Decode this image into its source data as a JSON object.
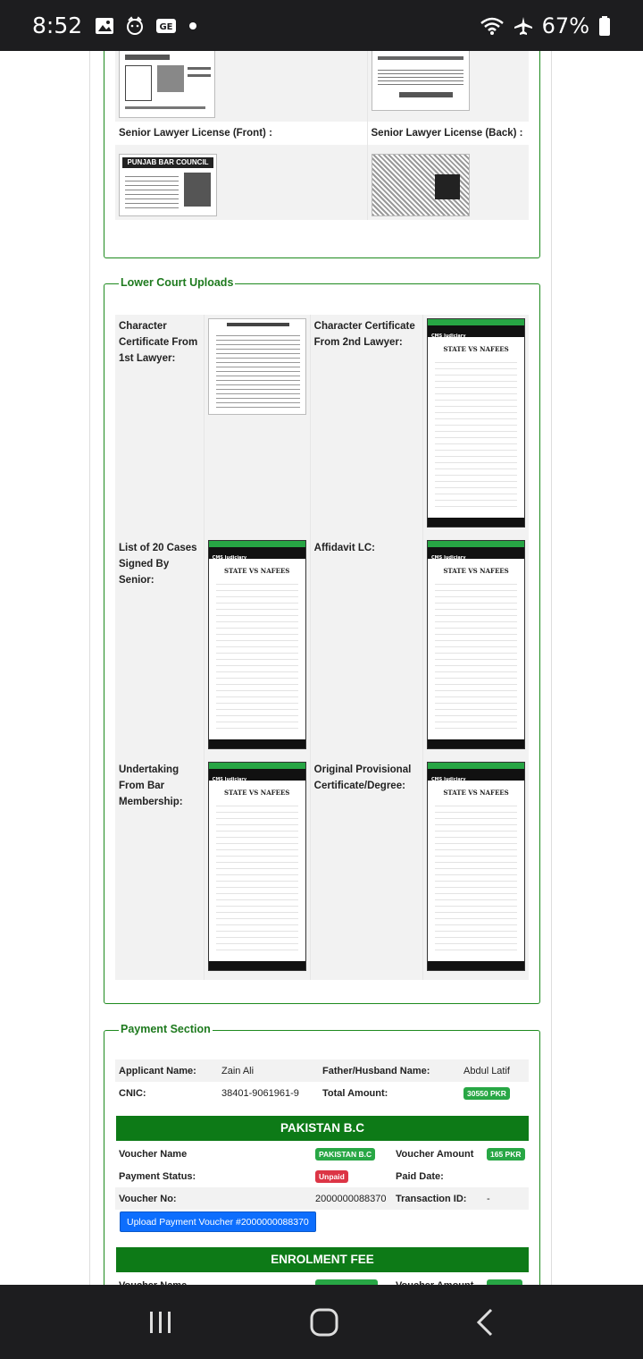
{
  "status_bar": {
    "time": "8:52",
    "battery": "67%"
  },
  "prev_section": {
    "rows": [
      {
        "left_label": "Senior Lawyer License (Front) :",
        "right_label": "Senior Lawyer License (Back) :"
      }
    ],
    "punjab_card_text": "PUNJAB BAR COUNCIL"
  },
  "lower_court": {
    "title": "Lower Court Uploads",
    "items": [
      {
        "label": "Character Certificate From 1st Lawyer:"
      },
      {
        "label": "Character Certificate From 2nd Lawyer:"
      },
      {
        "label": "List of 20 Cases Signed By Senior:"
      },
      {
        "label": "Affidavit LC:"
      },
      {
        "label": "Undertaking From Bar Membership:"
      },
      {
        "label": "Original Provisional Certificate/Degree:"
      }
    ],
    "phone_header": "CMS Judiciary",
    "phone_title": "STATE VS NAFEES"
  },
  "payment": {
    "title": "Payment Section",
    "applicant_label": "Applicant Name:",
    "applicant_value": "Zain Ali",
    "father_label": "Father/Husband Name:",
    "father_value": "Abdul Latif",
    "cnic_label": "CNIC:",
    "cnic_value": "38401-9061961-9",
    "total_label": "Total Amount:",
    "total_value": "30550 PKR",
    "vouchers": [
      {
        "header": "PAKISTAN B.C",
        "name_label": "Voucher Name",
        "name_value": "PAKISTAN B.C",
        "amount_label": "Voucher Amount",
        "amount_value": "165 PKR",
        "status_label": "Payment Status:",
        "status_value": "Unpaid",
        "paid_date_label": "Paid Date:",
        "paid_date_value": "",
        "voucher_no_label": "Voucher No:",
        "voucher_no_value": "2000000088370",
        "txn_label": "Transaction ID:",
        "txn_value": "-",
        "upload_label": "Upload Payment Voucher #2000000088370"
      },
      {
        "header": "ENROLMENT FEE",
        "name_label": "Voucher Name",
        "amount_label": "Voucher Amount"
      }
    ]
  },
  "colors": {
    "accent_green": "#0d7a17",
    "primary_blue": "#0d6efd",
    "unpaid_red": "#dc3545"
  }
}
